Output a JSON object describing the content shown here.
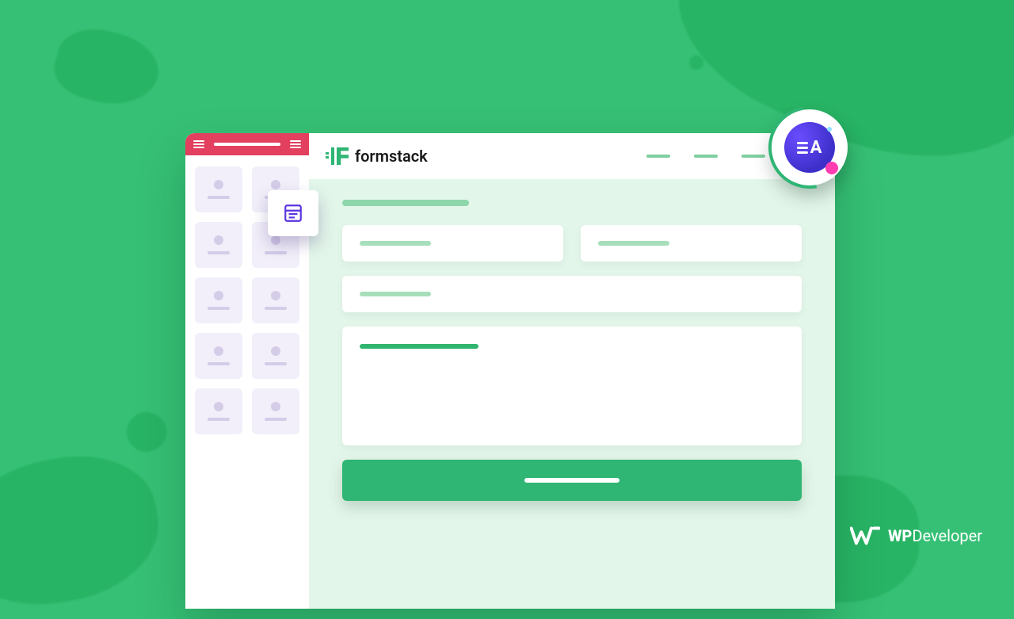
{
  "brand": {
    "name": "formstack"
  },
  "badge": {
    "label": "EA"
  },
  "footer": {
    "brand_strong": "WP",
    "brand_rest": "Developer"
  },
  "colors": {
    "bg": "#36c075",
    "bg_dark": "#28b465",
    "accent": "#2fb574",
    "sidebar_header": "#e2405e",
    "widget_bg": "#f2effa",
    "widget_fg": "#d5cce8",
    "badge_purple": "#4b3ad1",
    "badge_pink": "#ff3db0"
  },
  "drag_widget_icon": "form-widget-icon",
  "sidebar": {
    "widget_count": 10
  },
  "nav": {
    "link_count": 4
  },
  "form": {
    "fields": [
      {
        "type": "text"
      },
      {
        "type": "text"
      },
      {
        "type": "text_full"
      },
      {
        "type": "textarea"
      }
    ],
    "has_submit": true
  }
}
